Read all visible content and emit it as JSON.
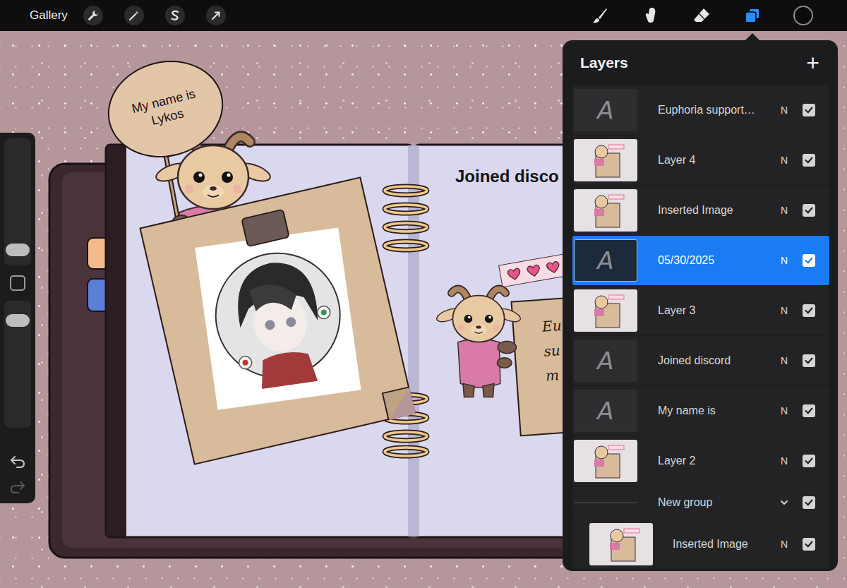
{
  "toolbar": {
    "gallery": "Gallery",
    "tools": [
      {
        "kind": "brush",
        "selected": false
      },
      {
        "kind": "smudge",
        "selected": false
      },
      {
        "kind": "eraser",
        "selected": false
      },
      {
        "kind": "layers",
        "selected": true
      }
    ]
  },
  "sidebar": {
    "sliders": [
      {
        "level": 0.08
      },
      {
        "level": 0.88
      }
    ]
  },
  "canvas": {
    "sign": "My name is Lykos",
    "heading": "Joined disco",
    "note_lines": [
      "Eu",
      "su",
      "m"
    ]
  },
  "layers_panel": {
    "title": "Layers",
    "add": "+",
    "layers": [
      {
        "name": "Euphoria support…",
        "kind": "text",
        "thumb": "A",
        "blend": "N",
        "visible": true,
        "selected": false,
        "in_group": false
      },
      {
        "name": "Layer 4",
        "kind": "image",
        "blend": "N",
        "visible": true,
        "selected": false,
        "in_group": false
      },
      {
        "name": "Inserted Image",
        "kind": "image",
        "blend": "N",
        "visible": true,
        "selected": false,
        "in_group": false
      },
      {
        "name": "05/30/2025",
        "kind": "text",
        "thumb": "A",
        "blend": "N",
        "visible": true,
        "selected": true,
        "in_group": false
      },
      {
        "name": "Layer 3",
        "kind": "image",
        "blend": "N",
        "visible": true,
        "selected": false,
        "in_group": false
      },
      {
        "name": "Joined discord",
        "kind": "text",
        "thumb": "A",
        "blend": "N",
        "visible": true,
        "selected": false,
        "in_group": false
      },
      {
        "name": "My name is",
        "kind": "text",
        "thumb": "A",
        "blend": "N",
        "visible": true,
        "selected": false,
        "in_group": false
      },
      {
        "name": "Layer 2",
        "kind": "image",
        "blend": "N",
        "visible": true,
        "selected": false,
        "in_group": false
      },
      {
        "name": "New group",
        "kind": "group",
        "expanded": true,
        "visible": true,
        "selected": false,
        "in_group": false
      },
      {
        "name": "Inserted Image",
        "kind": "image",
        "blend": "N",
        "visible": true,
        "selected": false,
        "in_group": true
      }
    ]
  }
}
